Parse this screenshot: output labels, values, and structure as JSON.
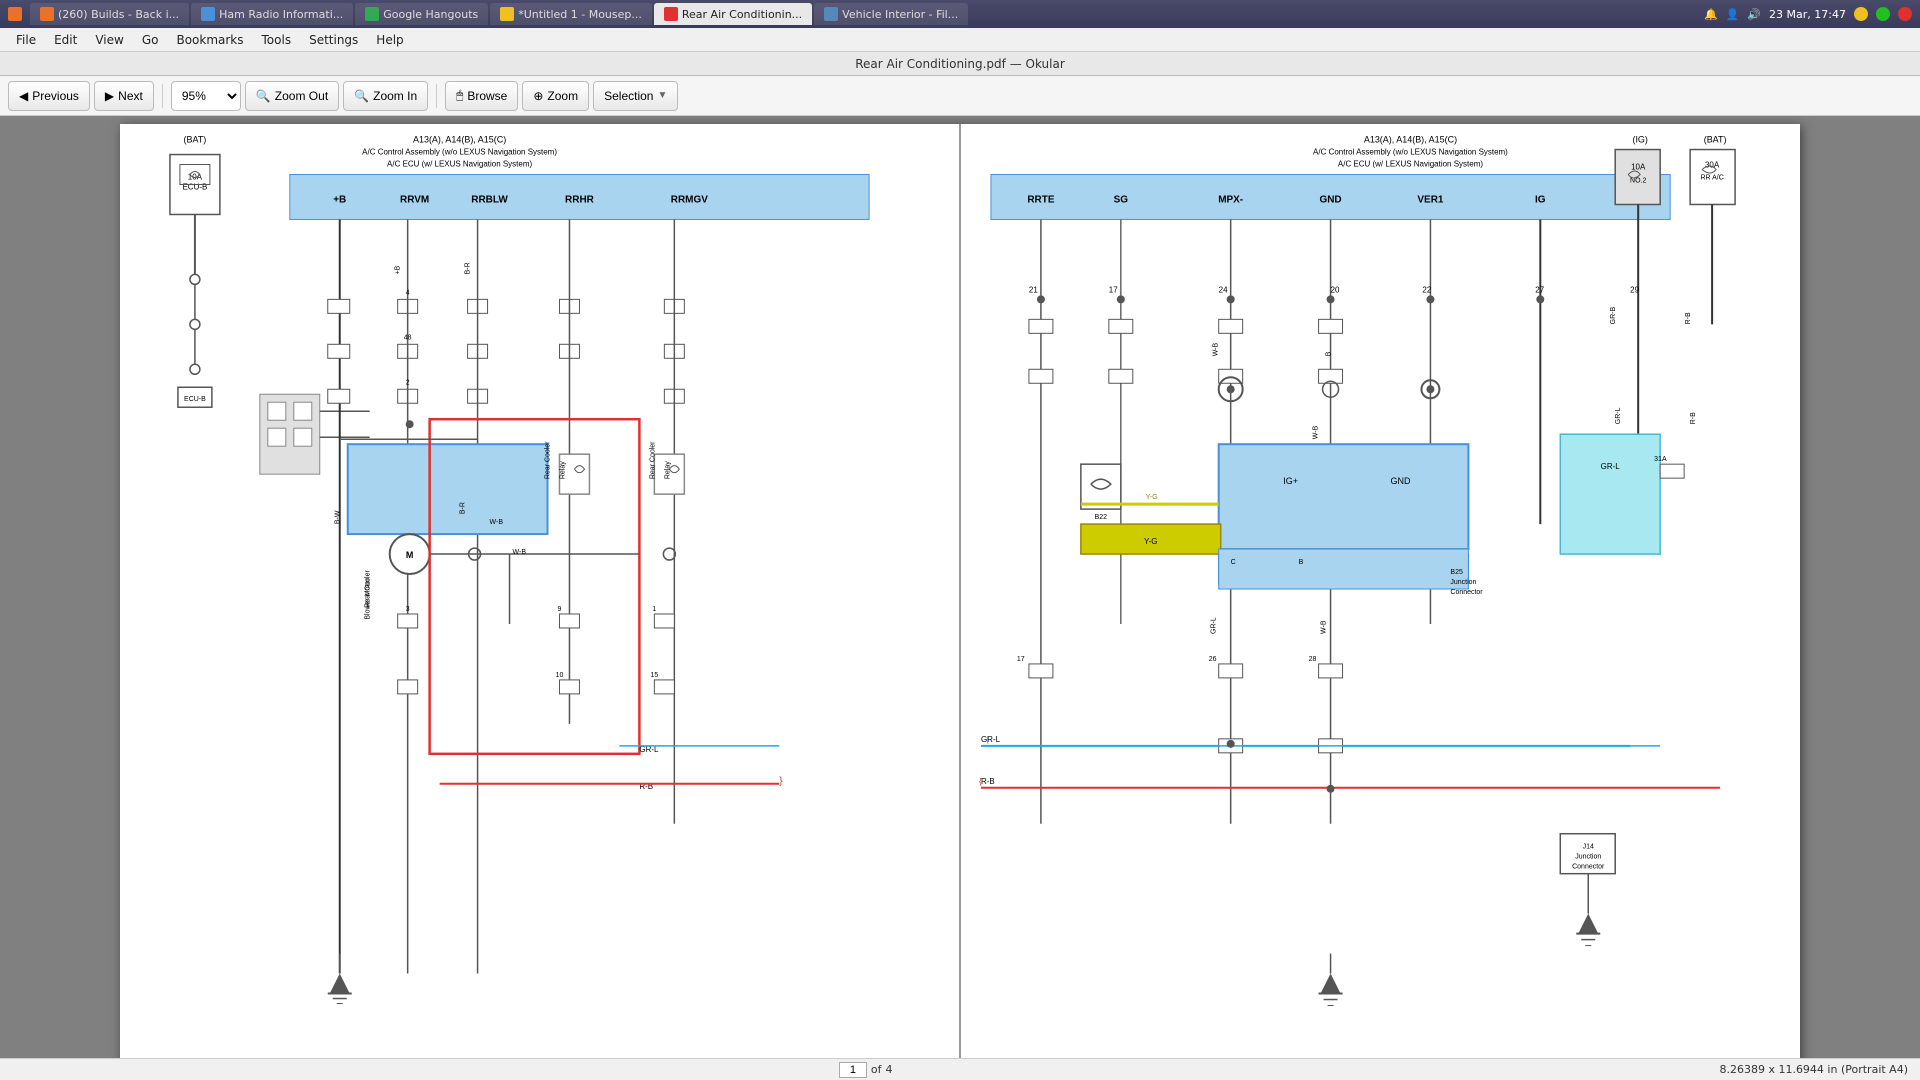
{
  "titlebar": {
    "title": "Rear Air Conditioning.pdf — Okular",
    "tabs": [
      {
        "id": "builds",
        "label": "(260) Builds - Back i...",
        "favicon": "orange",
        "active": false
      },
      {
        "id": "hamradio",
        "label": "Ham Radio Informati...",
        "favicon": "blue",
        "active": false
      },
      {
        "id": "hangouts",
        "label": "Google Hangouts",
        "favicon": "green",
        "active": false
      },
      {
        "id": "mousep",
        "label": "*Untitled 1 - Mousep...",
        "favicon": "yellow",
        "active": false
      },
      {
        "id": "rearair",
        "label": "Rear Air Conditionin...",
        "favicon": "pdf",
        "active": true
      },
      {
        "id": "vehicle",
        "label": "Vehicle Interior - Fil...",
        "favicon": "vehicle",
        "active": false
      }
    ],
    "datetime": "23 Mar, 17:47",
    "notification_icon": "🔔",
    "user_icon": "👤"
  },
  "menubar": {
    "items": [
      "File",
      "Edit",
      "View",
      "Go",
      "Bookmarks",
      "Tools",
      "Settings",
      "Help"
    ]
  },
  "app_title": "Rear Air Conditioning.pdf — Okular",
  "toolbar": {
    "previous_label": "Previous",
    "next_label": "Next",
    "zoom_out_label": "Zoom Out",
    "zoom_in_label": "Zoom In",
    "browse_label": "Browse",
    "zoom_label": "Zoom",
    "selection_label": "Selection",
    "zoom_value": "95%"
  },
  "statusbar": {
    "page_current": "1",
    "page_of": "of",
    "page_total": "4",
    "dimensions": "8.26389 x 11.6944 in (Portrait A4)"
  },
  "diagram": {
    "left_title": "A13(A), A14(B), A15(C)",
    "left_subtitle1": "A/C Control Assembly (w/o LEXUS Navigation System)",
    "left_subtitle2": "A/C ECU (w/ LEXUS Navigation System)",
    "right_title": "A13(A), A14(B), A15(C)",
    "right_subtitle1": "A/C Control Assembly (w/o LEXUS Navigation System)",
    "right_subtitle2": "A/C ECU (w/ LEXUS Navigation System)",
    "left_columns": [
      "+B",
      "RRVM",
      "RRBLW",
      "RRHR",
      "RRMGV"
    ],
    "right_columns": [
      "RRTE",
      "SG",
      "MPX-",
      "GND",
      "VER1",
      "IG"
    ]
  }
}
